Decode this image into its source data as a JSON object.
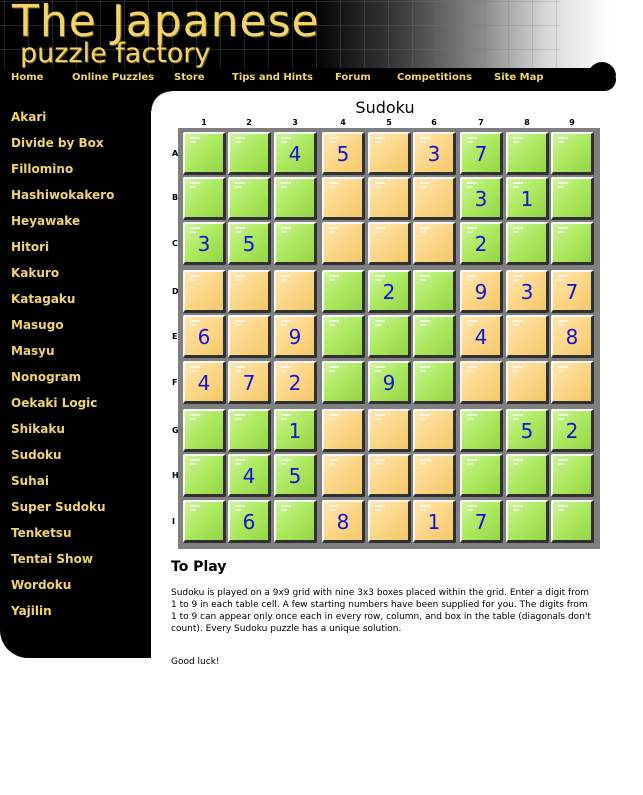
{
  "logo": {
    "line1": "The Japanese",
    "line2": "puzzle factory"
  },
  "nav": [
    "Home",
    "Online Puzzles",
    "Store",
    "Tips and Hints",
    "Forum",
    "Competitions",
    "Site Map"
  ],
  "sidebar": [
    "Akari",
    "Divide by Box",
    "Fillomino",
    "Hashiwokakero",
    "Heyawake",
    "Hitori",
    "Kakuro",
    "Katagaku",
    "Masugo",
    "Masyu",
    "Nonogram",
    "Oekaki Logic",
    "Shikaku",
    "Sudoku",
    "Suhai",
    "Super Sudoku",
    "Tenketsu",
    "Tentai Show",
    "Wordoku",
    "Yajilin"
  ],
  "puzzle": {
    "title": "Sudoku",
    "columns": [
      "1",
      "2",
      "3",
      "4",
      "5",
      "6",
      "7",
      "8",
      "9"
    ],
    "rows": [
      "A",
      "B",
      "C",
      "D",
      "E",
      "F",
      "G",
      "H",
      "I"
    ],
    "box_colors": [
      [
        "green",
        "orange",
        "green"
      ],
      [
        "orange",
        "green",
        "orange"
      ],
      [
        "green",
        "orange",
        "green"
      ]
    ],
    "grid": [
      [
        "",
        "",
        "4",
        "5",
        "",
        "3",
        "7",
        "",
        ""
      ],
      [
        "",
        "",
        "",
        "",
        "",
        "",
        "3",
        "1",
        ""
      ],
      [
        "3",
        "5",
        "",
        "",
        "",
        "",
        "2",
        "",
        ""
      ],
      [
        "",
        "",
        "",
        "",
        "2",
        "",
        "9",
        "3",
        "7"
      ],
      [
        "6",
        "",
        "9",
        "",
        "",
        "",
        "4",
        "",
        "8"
      ],
      [
        "4",
        "7",
        "2",
        "",
        "9",
        "",
        "",
        "",
        ""
      ],
      [
        "",
        "",
        "1",
        "",
        "",
        "",
        "",
        "5",
        "2"
      ],
      [
        "",
        "4",
        "5",
        "",
        "",
        "",
        "",
        "",
        ""
      ],
      [
        "",
        "6",
        "",
        "8",
        "",
        "1",
        "7",
        "",
        ""
      ]
    ]
  },
  "instructions": {
    "heading": "To Play",
    "body": "Sudoku is played on a 9x9 grid with nine 3x3 boxes placed within the grid. Enter a digit from 1 to 9 in each table cell. A few starting numbers have been supplied for you. The digits from 1 to 9 can appear only once each in every row, column, and box in the table (diagonals don't count). Every Sudoku puzzle has a unique solution.",
    "closing": "Good luck!"
  },
  "colors": {
    "gold": "#f0d46a",
    "digit": "#1414d2",
    "green_cell": "#aeea62",
    "orange_cell": "#fcd88c",
    "grid_border": "#7f7f7f"
  }
}
